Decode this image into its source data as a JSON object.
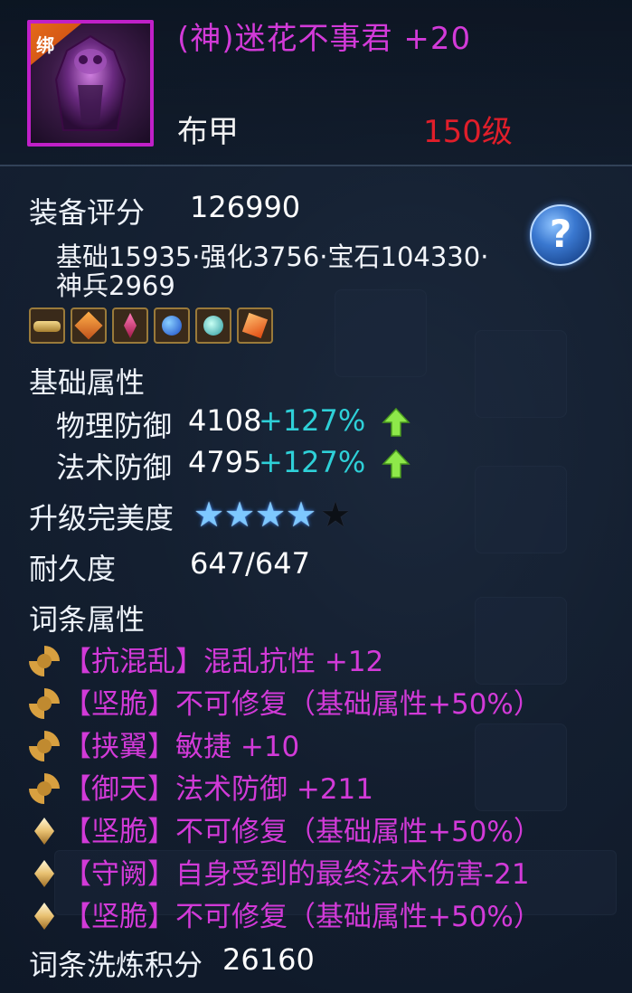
{
  "item": {
    "bind_label": "绑",
    "name": "(神)迷花不事君 +20",
    "type": "布甲",
    "level": "150级",
    "name_color": "#d23ad8",
    "level_color": "#e01e2a"
  },
  "score": {
    "label": "装备评分",
    "value": "126990",
    "breakdown_line1": "基础15935·强化3756·宝石104330·",
    "breakdown_line2": "神兵2969"
  },
  "help_label": "?",
  "gems": [
    "gold-bar-gem-icon",
    "amber-gem-icon",
    "ruby-gem-icon",
    "sapphire-gem-icon",
    "aqua-gem-icon",
    "fire-gem-icon"
  ],
  "base_attrs": {
    "title": "基础属性",
    "items": [
      {
        "name": "物理防御",
        "value": "4108",
        "bonus": "+127%"
      },
      {
        "name": "法术防御",
        "value": "4795",
        "bonus": "+127%"
      }
    ]
  },
  "perfection": {
    "label": "升级完美度",
    "stars_filled": 4,
    "stars_total": 5
  },
  "durability": {
    "label": "耐久度",
    "value": "647/647"
  },
  "affixes": {
    "title": "词条属性",
    "items": [
      {
        "icon": "swirl-icon",
        "text": "【抗混乱】混乱抗性 +12"
      },
      {
        "icon": "swirl-icon",
        "text": "【坚脆】不可修复（基础属性+50%）"
      },
      {
        "icon": "swirl-icon",
        "text": "【挟翼】敏捷 +10"
      },
      {
        "icon": "swirl-icon",
        "text": "【御天】法术防御 +211"
      },
      {
        "icon": "diamond-icon",
        "text": "【坚脆】不可修复（基础属性+50%）"
      },
      {
        "icon": "diamond-icon",
        "text": "【守阙】自身受到的最终法术伤害-21"
      },
      {
        "icon": "diamond-icon",
        "text": "【坚脆】不可修复（基础属性+50%）"
      }
    ]
  },
  "refine": {
    "label": "词条洗炼积分",
    "value": "26160"
  },
  "colors": {
    "accent_magenta": "#d23ad8",
    "bonus_cyan": "#2ed0d8",
    "arrow_green": "#8ee84a"
  }
}
